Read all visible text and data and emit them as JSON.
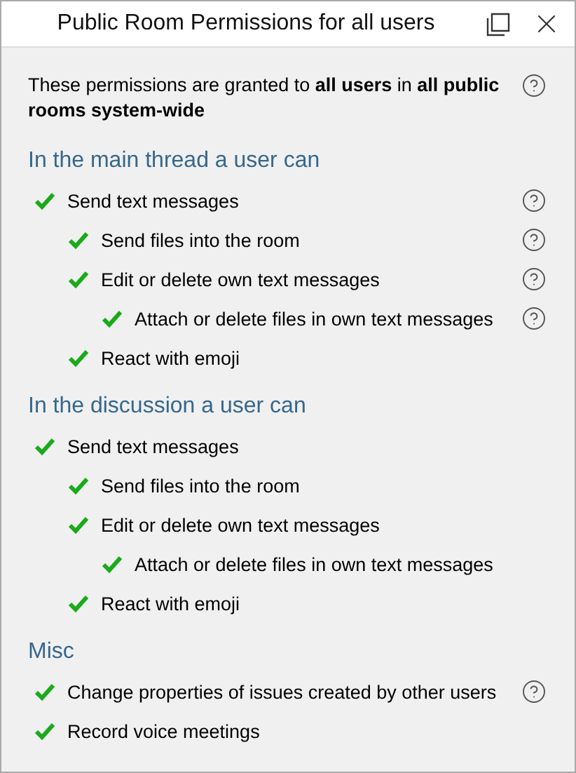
{
  "window": {
    "title": "Public Room Permissions for all users"
  },
  "intro": {
    "text": "These permissions are granted to **all users** in **all public rooms system-wide**",
    "help": true
  },
  "sections": [
    {
      "heading": "In the main thread a user can",
      "items": [
        {
          "label": "Send text messages",
          "checked": true,
          "help": true,
          "children": [
            {
              "label": "Send files into the room",
              "checked": true,
              "help": true
            },
            {
              "label": "Edit or delete own text messages",
              "checked": true,
              "help": true,
              "children": [
                {
                  "label": "Attach or delete files in own text messages",
                  "checked": true,
                  "help": true
                }
              ]
            },
            {
              "label": "React with emoji",
              "checked": true,
              "help": false
            }
          ]
        }
      ]
    },
    {
      "heading": "In the discussion a user can",
      "items": [
        {
          "label": "Send text messages",
          "checked": true,
          "help": false,
          "children": [
            {
              "label": "Send files into the room",
              "checked": true,
              "help": false
            },
            {
              "label": "Edit or delete own text messages",
              "checked": true,
              "help": false,
              "children": [
                {
                  "label": "Attach or delete files in own text messages",
                  "checked": true,
                  "help": false
                }
              ]
            },
            {
              "label": "React with emoji",
              "checked": true,
              "help": false
            }
          ]
        }
      ]
    },
    {
      "heading": "Misc",
      "items": [
        {
          "label": "Change properties of issues created by other users",
          "checked": true,
          "help": true
        },
        {
          "label": "Record voice meetings",
          "checked": true,
          "help": false
        }
      ]
    }
  ]
}
